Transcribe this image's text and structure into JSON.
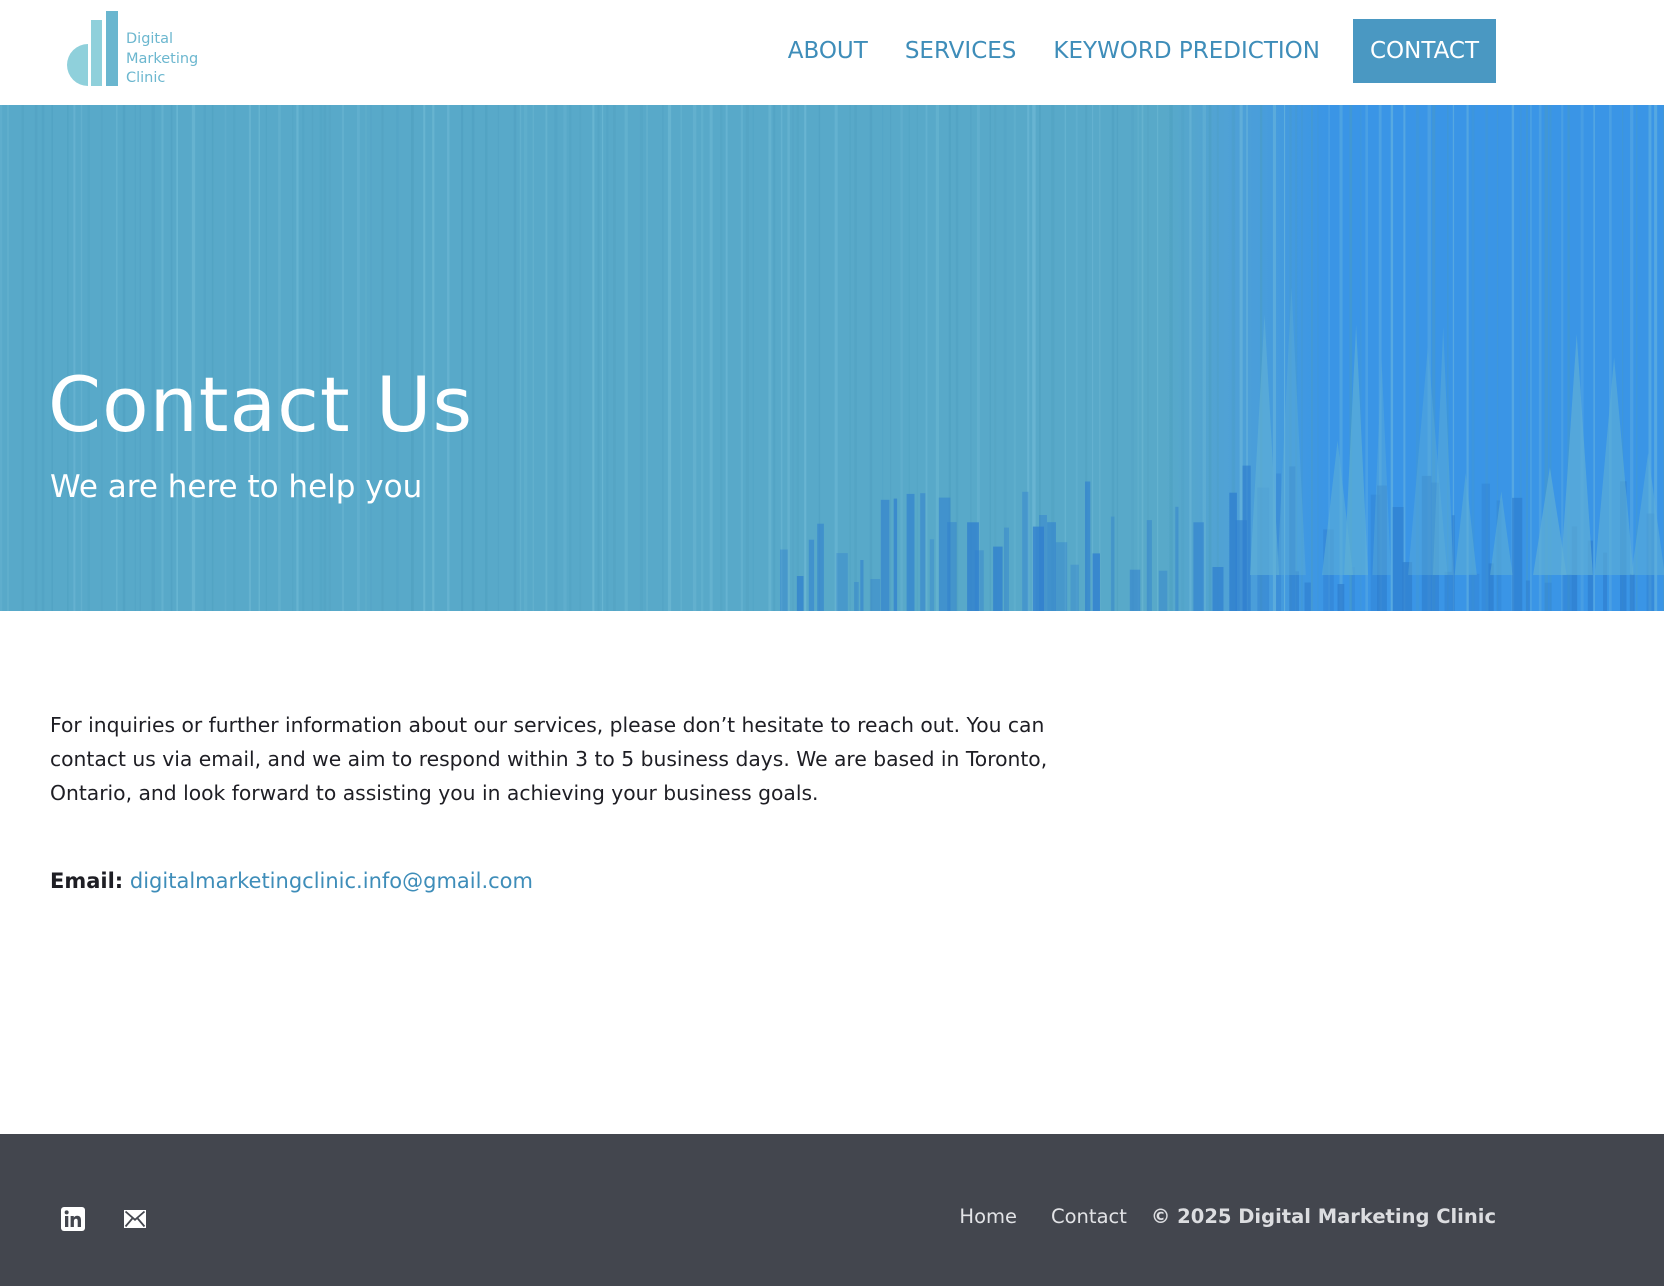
{
  "brand": {
    "logo_lines": [
      "Digital",
      "Marketing",
      "Clinic"
    ],
    "logo_colors": {
      "bar_light": "#8fd0db",
      "bar_dark": "#6ab6cf",
      "text": "#6cb7cf"
    }
  },
  "nav": {
    "items": [
      {
        "label": "ABOUT"
      },
      {
        "label": "SERVICES"
      },
      {
        "label": "KEYWORD PREDICTION"
      }
    ],
    "cta_label": "CONTACT"
  },
  "hero": {
    "title": "Contact Us",
    "subtitle": "We are here to help you",
    "colors": {
      "base": "#58a9c9",
      "accent": "#3a95e6"
    }
  },
  "content": {
    "intro": "For inquiries or further information about our services, please don’t hesitate to reach out. You can contact us via email, and we aim to respond within 3 to 5 business days. We are based in Toronto, Ontario, and look forward to assisting you in achieving your business goals.",
    "email_label": "Email:",
    "email": "digitalmarketingclinic.info@gmail.com"
  },
  "footer": {
    "social_icons": [
      "linkedin-icon",
      "mail-icon"
    ],
    "links": [
      {
        "label": "Home"
      },
      {
        "label": "Contact"
      }
    ],
    "copyright": "© 2025 Digital Marketing Clinic",
    "colors": {
      "background": "#43464e",
      "text": "#e2e3e6"
    }
  },
  "theme": {
    "accent": "#3e8db9",
    "cta": "#4a98c2"
  }
}
